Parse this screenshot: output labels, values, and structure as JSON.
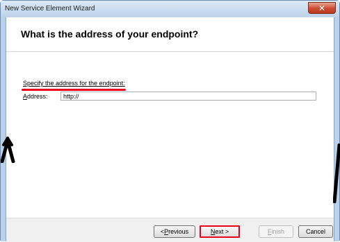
{
  "window": {
    "title": "New Service Element Wizard",
    "close_icon": "close-icon"
  },
  "page": {
    "heading": "What is the address of your endpoint?",
    "instruction": "Specify the address for the endpoint:",
    "address_label": "Address:",
    "address_value": "http://"
  },
  "buttons": {
    "previous": {
      "accel": "P",
      "rest": "revious",
      "prefix": "< ",
      "enabled": true
    },
    "next": {
      "accel": "N",
      "rest": "ext >",
      "enabled": true
    },
    "finish": {
      "accel": "F",
      "rest": "inish",
      "enabled": false
    },
    "cancel": {
      "label": "Cancel",
      "enabled": true
    }
  },
  "colors": {
    "annotation": "#e8001a",
    "titlebar": "#bcd3ea",
    "close_button": "#cc4b31"
  }
}
